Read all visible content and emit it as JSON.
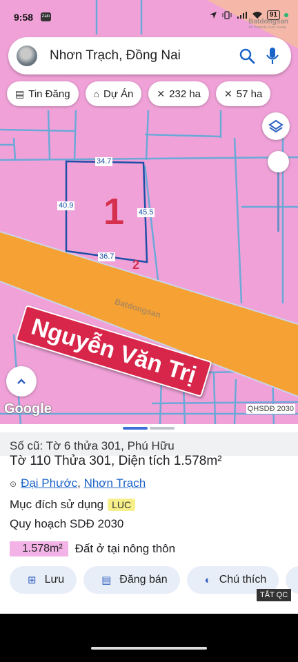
{
  "status_bar": {
    "time": "9:58",
    "zalo_label": "Zalo",
    "battery": "91"
  },
  "watermark": {
    "brand": "Batdongsan",
    "tagline": "An Property Guru Group",
    "center": "Batdongsan"
  },
  "search": {
    "query": "Nhơn Trạch, Đồng Nai",
    "search_icon": "search-icon",
    "mic_icon": "mic-icon"
  },
  "chips": [
    {
      "icon": "listing-icon",
      "label": "Tin Đăng"
    },
    {
      "icon": "project-icon",
      "label": "Dự Án"
    },
    {
      "icon": "area-icon",
      "label": "232 ha"
    },
    {
      "icon": "area-icon",
      "label": "57 ha"
    }
  ],
  "map": {
    "plot_number": "1",
    "corner_number": "2",
    "dimensions": {
      "top": "34.7",
      "left": "40.9",
      "right": "45.5",
      "bottom": "36.7"
    },
    "road_name": "Nguyễn Văn Trị",
    "google_logo": "Google",
    "layer_badge": "QHSDĐ 2030",
    "colors": {
      "land": "#f0a2d8",
      "road": "#f6a133",
      "parcel_lines": "#6ba8d8"
    }
  },
  "sheet": {
    "old_info": "Số cũ: Tờ 6 thửa 301, Phú Hữu",
    "title": "Tờ 110 Thửa 301, Diện tích 1.578m²",
    "location": {
      "ward": "Đại Phước",
      "separator": ", ",
      "district": "Nhơn Trạch"
    },
    "purpose_label": "Mục đích sử dụng",
    "purpose_code": "LUC",
    "plan_label": "Quy hoạch SDĐ 2030",
    "plan_area": "1.578m²",
    "plan_use": "Đất ở tại nông thôn",
    "actions": [
      {
        "icon": "add-document-icon",
        "label": "Lưu"
      },
      {
        "icon": "listing-icon",
        "label": "Đăng bán"
      },
      {
        "icon": "legend-icon",
        "label": "Chú thích"
      }
    ],
    "ad_hide": "TẮT QC"
  }
}
